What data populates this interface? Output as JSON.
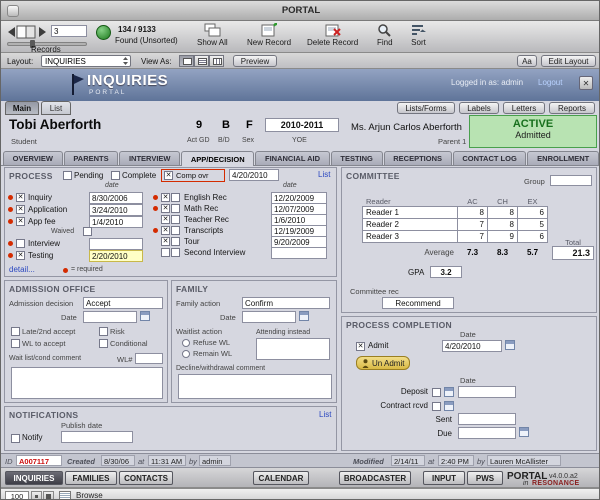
{
  "colors": {
    "content-bg": "#d6d7e0",
    "header-blue1": "#93a3c2",
    "header-blue2": "#5f7499",
    "green-bg": "#b8e3b2",
    "green-text": "#17701d",
    "hl-yellow": "#ffffc6",
    "req-red": "#d42b00",
    "link-blue": "#2b48c0",
    "id-red": "#cc1111",
    "unadmit-yellow": "#f2dd88"
  },
  "window": {
    "title": "PORTAL"
  },
  "toolbar": {
    "current_record": "3",
    "found_count": "134 / 9133",
    "found_status": "Found (Unsorted)",
    "records_label": "Records",
    "show_all": "Show All",
    "new_record": "New Record",
    "delete_record": "Delete Record",
    "find": "Find",
    "sort": "Sort"
  },
  "layout_bar": {
    "layout_label": "Layout:",
    "layout_value": "INQUIRIES",
    "view_as_label": "View As:",
    "preview": "Preview",
    "aa": "Aa",
    "edit_layout": "Edit Layout"
  },
  "header": {
    "title": "INQUIRIES",
    "subtitle": "PORTAL",
    "logged_in": "Logged in as: admin",
    "logout": "Logout",
    "close": "✕"
  },
  "view_tabs": {
    "main": "Main",
    "list": "List"
  },
  "header_buttons": {
    "lists_forms": "Lists/Forms",
    "labels": "Labels",
    "letters": "Letters",
    "reports": "Reports"
  },
  "student": {
    "name": "Tobi Aberforth",
    "name_label": "Student",
    "grade": "9",
    "grade_label": "Act GD",
    "bd": "B",
    "bd_label": "B/D",
    "sex": "F",
    "sex_label": "Sex",
    "yoe": "2010-2011",
    "yoe_label": "YOE",
    "parent": "Ms. Arjun Carlos Aberforth",
    "parent_label": "Parent 1",
    "status": "ACTIVE",
    "status_sub": "Admitted"
  },
  "tabs": [
    {
      "label": "OVERVIEW",
      "active": false
    },
    {
      "label": "PARENTS",
      "active": false
    },
    {
      "label": "INTERVIEW",
      "active": false
    },
    {
      "label": "APP/DECISION",
      "active": true
    },
    {
      "label": "FINANCIAL AID",
      "active": false
    },
    {
      "label": "TESTING",
      "active": false
    },
    {
      "label": "RECEPTIONS",
      "active": false
    },
    {
      "label": "CONTACT LOG",
      "active": false
    },
    {
      "label": "ENROLLMENT",
      "active": false
    }
  ],
  "process": {
    "title": "PROCESS",
    "pending": "Pending",
    "complete": "Complete",
    "comp_ovr": "Comp ovr",
    "comp_ovr_checked": true,
    "comp_ovr_date": "4/20/2010",
    "list_link": "List",
    "date_header": "date",
    "left_rows": [
      {
        "label": "Inquiry",
        "date": "8/30/2006",
        "checked": true,
        "highlight": false
      },
      {
        "label": "Application",
        "date": "3/24/2010",
        "checked": true,
        "highlight": false
      },
      {
        "label": "App fee",
        "date": "1/4/2010",
        "checked": true,
        "highlight": false
      },
      {
        "label": "Interview",
        "date": "",
        "checked": false,
        "highlight": false
      },
      {
        "label": "Testing",
        "date": "2/20/2010",
        "checked": true,
        "highlight": true
      }
    ],
    "waived": "Waived",
    "right_rows": [
      {
        "label": "English Rec",
        "date": "12/20/2009",
        "checked": true,
        "required": true
      },
      {
        "label": "Math Rec",
        "date": "12/07/2009",
        "checked": true,
        "required": true
      },
      {
        "label": "Teacher Rec",
        "date": "1/6/2010",
        "checked": true,
        "required": false
      },
      {
        "label": "Transcripts",
        "date": "12/19/2009",
        "checked": true,
        "required": true
      },
      {
        "label": "Tour",
        "date": "9/20/2009",
        "checked": true,
        "required": false
      },
      {
        "label": "Second Interview",
        "date": "",
        "checked": false,
        "required": false
      }
    ],
    "detail_link": "detail...",
    "required_note": "= required"
  },
  "committee": {
    "title": "COMMITTEE",
    "group_label": "Group",
    "group_value": "",
    "reader_header": "Reader",
    "col_headers": [
      "AC",
      "CH",
      "EX"
    ],
    "rows": [
      {
        "name": "Reader 1",
        "values": [
          "8",
          "8",
          "6"
        ]
      },
      {
        "name": "Reader 2",
        "values": [
          "7",
          "8",
          "5"
        ]
      },
      {
        "name": "Reader 3",
        "values": [
          "7",
          "9",
          "6"
        ]
      }
    ],
    "average_label": "Average",
    "averages": [
      "7.3",
      "8.3",
      "5.7"
    ],
    "total_label": "Total",
    "total": "21.3",
    "gpa_label": "GPA",
    "gpa": "3.2",
    "rec_label": "Committee rec",
    "rec_value": "Recommend"
  },
  "admission": {
    "title": "ADMISSION OFFICE",
    "decision_label": "Admission decision",
    "decision_value": "Accept",
    "date_label": "Date",
    "cb1": "Late/2nd accept",
    "cb2": "Risk",
    "cb3": "WL to accept",
    "cb4": "Conditional",
    "comment_label": "Wait list/cond comment",
    "wl_label": "WL#"
  },
  "family": {
    "title": "FAMILY",
    "action_label": "Family action",
    "action_value": "Confirm",
    "date_label": "Date",
    "waitlist_label": "Waitlist action",
    "refuse": "Refuse WL",
    "remain": "Remain WL",
    "attending_label": "Attending instead",
    "decline_label": "Decline/withdrawal comment"
  },
  "completion": {
    "title": "PROCESS COMPLETION",
    "date_label": "Date",
    "admit": "Admit",
    "admit_checked": true,
    "admit_date": "4/20/2010",
    "unadmit": "Un Admit",
    "date_label2": "Date",
    "deposit": "Deposit",
    "contract": "Contract rcvd",
    "sent": "Sent",
    "due": "Due"
  },
  "notifications": {
    "title": "NOTIFICATIONS",
    "list_link": "List",
    "notify": "Notify",
    "publish_label": "Publish date"
  },
  "record_info": {
    "id_label": "ID",
    "id_value": "A007117",
    "created_label": "Created",
    "created_date": "8/30/06",
    "at1": "at",
    "created_time": "11:31 AM",
    "by1": "by",
    "created_by": "admin",
    "modified_label": "Modified",
    "modified_date": "2/14/11",
    "at2": "at",
    "modified_time": "2:40 PM",
    "by2": "by",
    "modified_by": "Lauren McAllister"
  },
  "bottom_nav": {
    "inquiries": "INQUIRIES",
    "families": "FAMILIES",
    "contacts": "CONTACTS",
    "calendar": "CALENDAR",
    "broadcaster": "BROADCASTER",
    "input": "INPUT",
    "pws": "PWS",
    "brand": "PORTAL",
    "version": "v4.0.0.a2",
    "brand2_prefix": "in",
    "brand2": "RESONANCE"
  },
  "status_bar": {
    "zoom": "100",
    "mode": "Browse"
  }
}
